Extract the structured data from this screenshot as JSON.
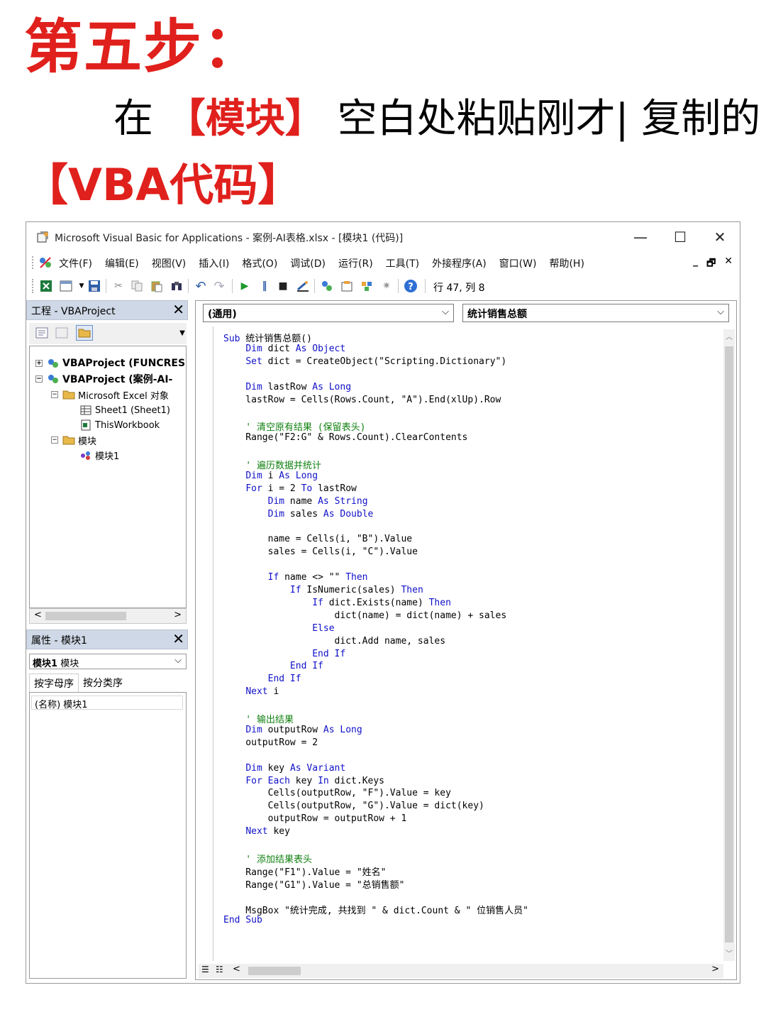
{
  "heading": {
    "step": "第五步：",
    "line2_pre": "在",
    "line2_highlight": "【模块】",
    "line2_post": "空白处粘贴刚才| 复制的",
    "line3": "【VBA代码】"
  },
  "window": {
    "title": "Microsoft Visual Basic for Applications - 案例-AI表格.xlsx - [模块1 (代码)]",
    "minimize": "—",
    "maximize": "☐",
    "close": "✕",
    "menus": [
      "文件(F)",
      "编辑(E)",
      "视图(V)",
      "插入(I)",
      "格式(O)",
      "调试(D)",
      "运行(R)",
      "工具(T)",
      "外接程序(A)",
      "窗口(W)",
      "帮助(H)"
    ],
    "inner_min": "_",
    "inner_restore": "🗗",
    "inner_close": "✕",
    "position": "行 47, 列 8"
  },
  "project": {
    "title": "工程 - VBAProject",
    "close": "✕",
    "tree": [
      {
        "label": "VBAProject (FUNCRES",
        "expander": "+"
      },
      {
        "label": "VBAProject (案例-AI-",
        "expander": "−"
      },
      {
        "label": "Microsoft Excel 对象",
        "expander": "−"
      },
      {
        "label": "Sheet1 (Sheet1)",
        "expander": ""
      },
      {
        "label": "ThisWorkbook",
        "expander": ""
      },
      {
        "label": "模块",
        "expander": "−"
      },
      {
        "label": "模块1",
        "expander": ""
      }
    ],
    "scroll_left": "<",
    "scroll_right": ">"
  },
  "properties": {
    "title": "属性 - 模块1",
    "close": "✕",
    "object_name": "模块1",
    "object_type": "模块",
    "tab_alpha": "按字母序",
    "tab_category": "按分类序",
    "row_name": "(名称)",
    "row_value": "模块1"
  },
  "code": {
    "object_combo": "(通用)",
    "proc_combo": "统计销售总额",
    "combo_arrow": "⌵",
    "lines": [
      "Sub 统计销售总额()",
      "    Dim dict As Object",
      "    Set dict = CreateObject(\"Scripting.Dictionary\")",
      "",
      "    Dim lastRow As Long",
      "    lastRow = Cells(Rows.Count, \"A\").End(xlUp).Row",
      "",
      "    ' 清空原有结果 (保留表头)",
      "    Range(\"F2:G\" & Rows.Count).ClearContents",
      "",
      "    ' 遍历数据并统计",
      "    Dim i As Long",
      "    For i = 2 To lastRow",
      "        Dim name As String",
      "        Dim sales As Double",
      "",
      "        name = Cells(i, \"B\").Value",
      "        sales = Cells(i, \"C\").Value",
      "",
      "        If name <> \"\" Then",
      "            If IsNumeric(sales) Then",
      "                If dict.Exists(name) Then",
      "                    dict(name) = dict(name) + sales",
      "                Else",
      "                    dict.Add name, sales",
      "                End If",
      "            End If",
      "        End If",
      "    Next i",
      "",
      "    ' 输出结果",
      "    Dim outputRow As Long",
      "    outputRow = 2",
      "",
      "    Dim key As Variant",
      "    For Each key In dict.Keys",
      "        Cells(outputRow, \"F\").Value = key",
      "        Cells(outputRow, \"G\").Value = dict(key)",
      "        outputRow = outputRow + 1",
      "    Next key",
      "",
      "    ' 添加结果表头",
      "    Range(\"F1\").Value = \"姓名\"",
      "    Range(\"G1\").Value = \"总销售额\"",
      "",
      "    MsgBox \"统计完成, 共找到 \" & dict.Count & \" 位销售人员\"",
      "End Sub"
    ]
  },
  "colors": {
    "keyword": "#1010c8",
    "comment": "#108010",
    "heading_red": "#e0201c"
  }
}
